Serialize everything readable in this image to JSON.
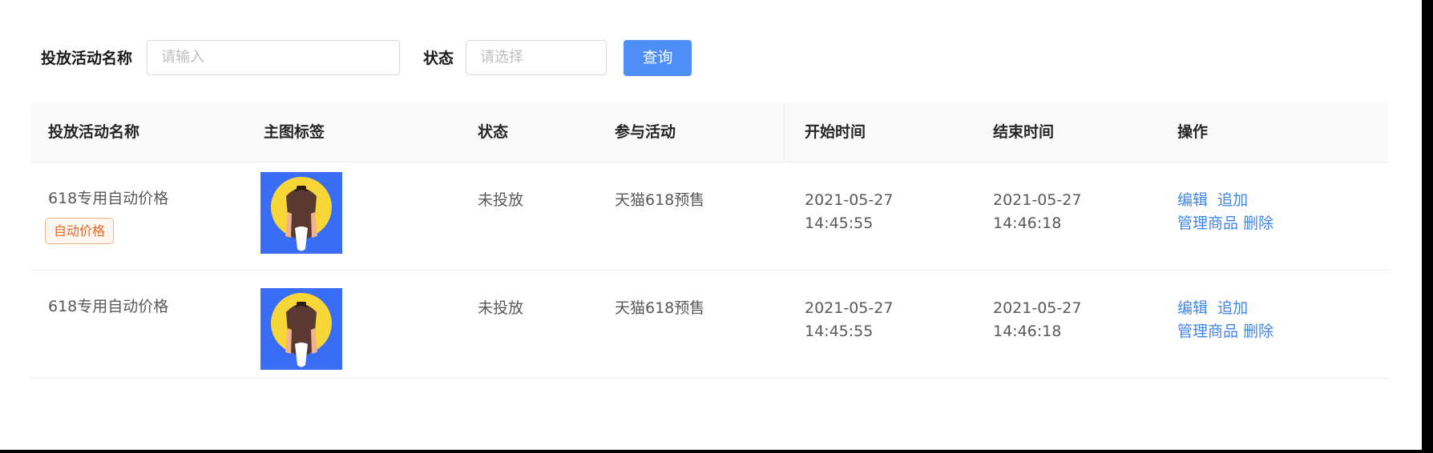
{
  "filter": {
    "name_label": "投放活动名称",
    "name_placeholder": "请输入",
    "status_label": "状态",
    "status_placeholder": "请选择",
    "query_button": "查询"
  },
  "table": {
    "columns": [
      "投放活动名称",
      "主图标签",
      "状态",
      "参与活动",
      "开始时间",
      "结束时间",
      "操作"
    ],
    "rows": [
      {
        "name": "618专用自动价格",
        "tag": "自动价格",
        "image": "main-image-thumbnail",
        "status": "未投放",
        "activity": "天猫618预售",
        "start_date": "2021-05-27",
        "start_time": "14:45:55",
        "end_date": "2021-05-27",
        "end_time": "14:46:18",
        "actions": [
          "编辑",
          "追加",
          "管理商品",
          "删除"
        ]
      },
      {
        "name": "618专用自动价格",
        "tag": "",
        "image": "main-image-thumbnail",
        "status": "未投放",
        "activity": "天猫618预售",
        "start_date": "2021-05-27",
        "start_time": "14:45:55",
        "end_date": "2021-05-27",
        "end_time": "14:46:18",
        "actions": [
          "编辑",
          "追加",
          "管理商品",
          "删除"
        ]
      }
    ]
  },
  "colors": {
    "primary": "#4d8ef7",
    "link": "#3f86ee",
    "tag_text": "#e1692e",
    "tag_border": "#f4b28a",
    "thumb_bg": "#3a6df5",
    "thumb_circle": "#f7d737"
  }
}
